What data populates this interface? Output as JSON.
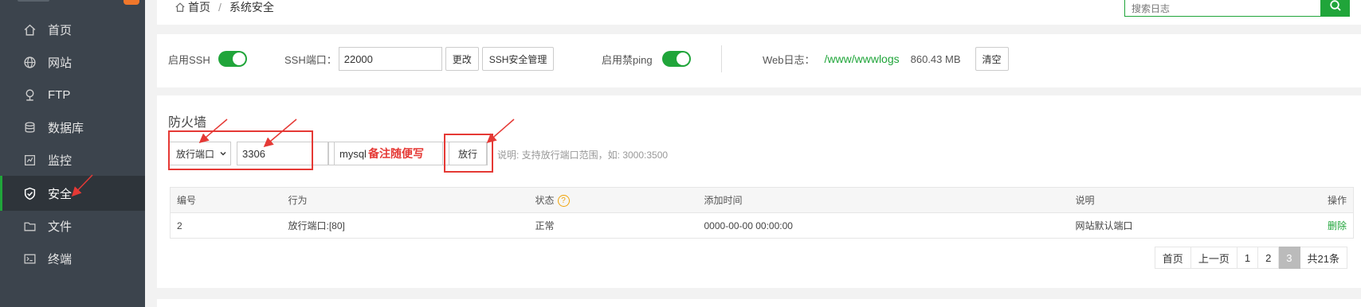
{
  "sidebar": {
    "items": [
      {
        "label": "首页",
        "icon": "home-icon"
      },
      {
        "label": "网站",
        "icon": "globe-icon"
      },
      {
        "label": "FTP",
        "icon": "ftp-icon"
      },
      {
        "label": "数据库",
        "icon": "database-icon"
      },
      {
        "label": "监控",
        "icon": "monitor-icon"
      },
      {
        "label": "安全",
        "icon": "shield-icon",
        "active": true
      },
      {
        "label": "文件",
        "icon": "folder-icon"
      },
      {
        "label": "终端",
        "icon": "terminal-icon"
      }
    ]
  },
  "breadcrumb": {
    "home": "首页",
    "separator": "/",
    "current": "系统安全"
  },
  "log_search": {
    "placeholder": "搜索日志"
  },
  "ssh": {
    "enable_ssh_label": "启用SSH",
    "port_label": "SSH端口：",
    "port_value": "22000",
    "change_button": "更改",
    "manage_button": "SSH安全管理",
    "ping_label": "启用禁ping",
    "weblog_label": "Web日志：",
    "weblog_path": "/www/wwwlogs",
    "weblog_size": "860.43 MB",
    "clear_button": "清空"
  },
  "firewall": {
    "title": "防火墙",
    "type_select": "放行端口",
    "port_value": "3306",
    "remark_value": "mysql",
    "remark_annotation": "备注随便写",
    "allow_button": "放行",
    "hint": "说明: 支持放行端口范围，如: 3000:3500",
    "columns": [
      "编号",
      "行为",
      "状态",
      "添加时间",
      "说明",
      "操作"
    ],
    "rows": [
      {
        "id": "2",
        "action": "放行端口:[80]",
        "status": "正常",
        "time": "0000-00-00 00:00:00",
        "note": "网站默认端口",
        "op": "删除"
      }
    ],
    "pagination": [
      "首页",
      "上一页",
      "1",
      "2",
      "3",
      "共21条"
    ],
    "current_page": "3"
  },
  "colors": {
    "accent": "#20a53a",
    "sidebar_bg": "#3c444d",
    "annotation": "#e53935"
  }
}
